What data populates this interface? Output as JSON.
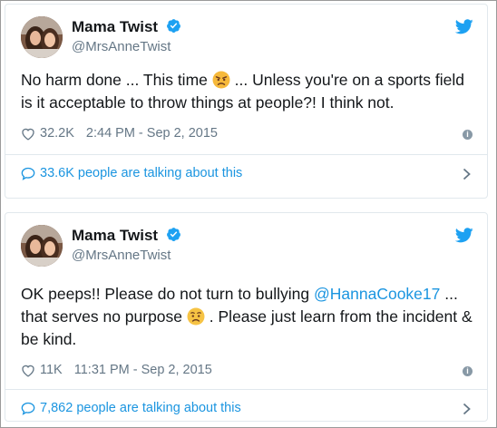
{
  "colors": {
    "link": "#1b95e0",
    "muted": "#657786",
    "text": "#14171a",
    "border": "#e1e8ed"
  },
  "tweets": [
    {
      "author": {
        "name": "Mama Twist",
        "handle": "@MrsAnneTwist",
        "verified_icon": "verified-badge-icon"
      },
      "text_parts": {
        "a": "No harm done ... This time",
        "emoji": "angry-face-emoji",
        "b": "... Unless you're on a sports field is it acceptable to throw things at people?! I think not."
      },
      "likes": "32.2K",
      "timestamp": "2:44 PM - Sep 2, 2015",
      "talking": "33.6K people are talking about this"
    },
    {
      "author": {
        "name": "Mama Twist",
        "handle": "@MrsAnneTwist",
        "verified_icon": "verified-badge-icon"
      },
      "text_parts": {
        "a": "OK peeps!! Please do not turn to bullying",
        "mention": "@HannaCooke17",
        "b": "... that serves no purpose",
        "emoji": "worried-face-emoji",
        "c": ". Please just learn from the incident & be kind."
      },
      "likes": "11K",
      "timestamp": "11:31 PM - Sep 2, 2015",
      "talking": "7,862 people are talking about this"
    }
  ]
}
